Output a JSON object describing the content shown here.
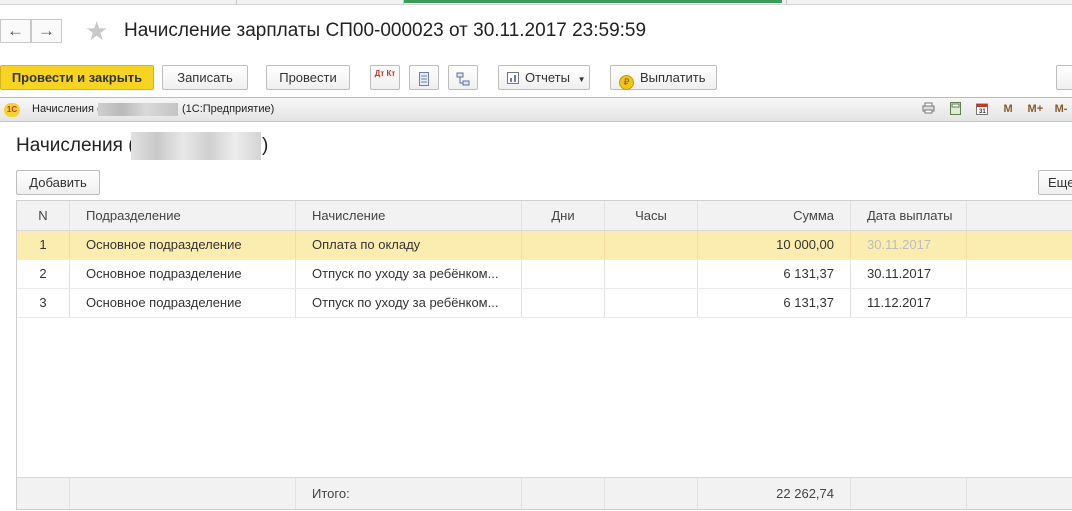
{
  "document": {
    "title": "Начисление зарплаты СП00-000023 от 30.11.2017 23:59:59"
  },
  "nav": {
    "back": "←",
    "forward": "→",
    "favorite": "★"
  },
  "toolbar": {
    "post_close": "Провести и закрыть",
    "save": "Записать",
    "post": "Провести",
    "dtkt_icon_text": "Дт Кт",
    "reports": "Отчеты",
    "pay": "Выплатить",
    "pay_icon_text": "₽"
  },
  "window": {
    "title_prefix": "Начисления (",
    "app": "(1С:Предприятие)",
    "logo_text": "1С",
    "icons": [
      "print-icon",
      "calculator-icon",
      "calendar-icon",
      "M",
      "M+",
      "M-"
    ]
  },
  "form": {
    "title_prefix": "Начисления (",
    "title_suffix": ")",
    "add_button": "Добавить",
    "more_button": "Еще"
  },
  "table": {
    "columns": [
      "N",
      "Подразделение",
      "Начисление",
      "Дни",
      "Часы",
      "Сумма",
      "Дата выплаты"
    ],
    "rows": [
      {
        "n": "1",
        "department": "Основное подразделение",
        "accrual": "Оплата по окладу",
        "days": "",
        "hours": "",
        "amount": "10 000,00",
        "pay_date": "30.11.2017",
        "selected": true
      },
      {
        "n": "2",
        "department": "Основное подразделение",
        "accrual": "Отпуск по уходу за ребёнком...",
        "days": "",
        "hours": "",
        "amount": "6 131,37",
        "pay_date": "30.11.2017",
        "selected": false
      },
      {
        "n": "3",
        "department": "Основное подразделение",
        "accrual": "Отпуск по уходу за ребёнком...",
        "days": "",
        "hours": "",
        "amount": "6 131,37",
        "pay_date": "11.12.2017",
        "selected": false
      }
    ],
    "footer": {
      "label": "Итого:",
      "total": "22 262,74"
    }
  },
  "colors": {
    "primary_button": "#f6d421",
    "selected_row": "#fbedb0",
    "active_tab": "#3a9b5c"
  }
}
